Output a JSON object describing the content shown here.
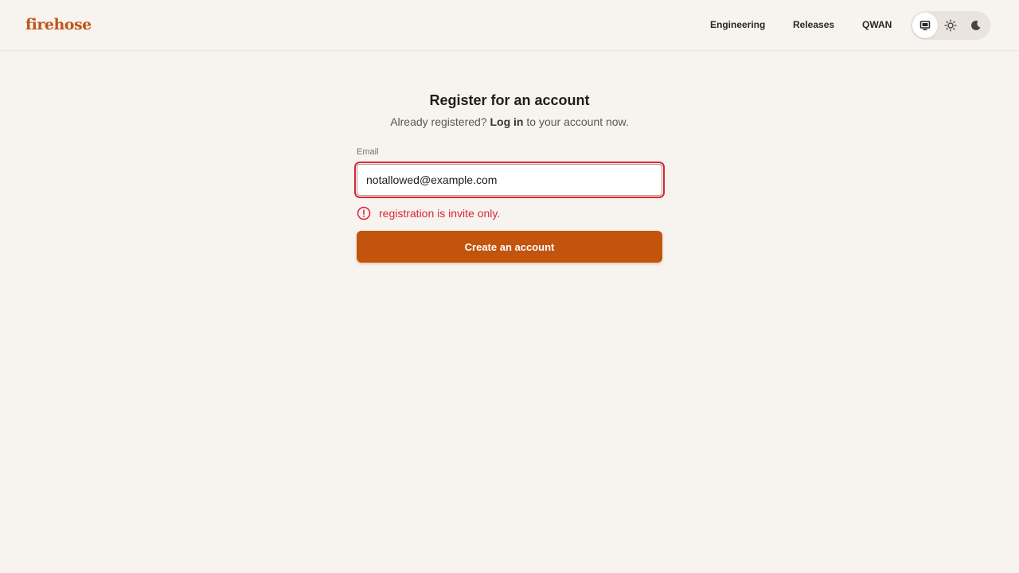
{
  "header": {
    "logo": "firehose",
    "nav": [
      "Engineering",
      "Releases",
      "QWAN"
    ],
    "theme_options": [
      {
        "icon": "monitor-icon",
        "active": true
      },
      {
        "icon": "sun-icon",
        "active": false
      },
      {
        "icon": "moon-icon",
        "active": false
      }
    ]
  },
  "form": {
    "title": "Register for an account",
    "subtitle_prefix": "Already registered?",
    "login_link": "Log in",
    "subtitle_suffix": "to your account now.",
    "email_label": "Email",
    "email_value": "notallowed@example.com",
    "error": "registration is invite only.",
    "submit_label": "Create an account"
  },
  "colors": {
    "brand": "#c2541a",
    "button": "#c2540d",
    "error": "#d8263a",
    "background": "#f7f4ef"
  }
}
